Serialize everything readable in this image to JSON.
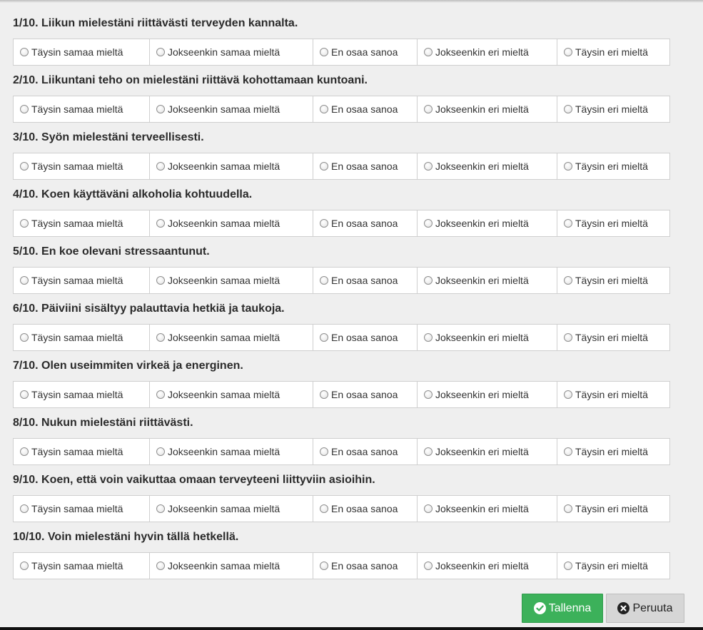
{
  "options": [
    "Täysin samaa mieltä",
    "Jokseenkin samaa mieltä",
    "En osaa sanoa",
    "Jokseenkin eri mieltä",
    "Täysin eri mieltä"
  ],
  "questions": [
    "1/10. Liikun mielestäni riittävästi terveyden kannalta.",
    "2/10. Liikuntani teho on mielestäni riittävä kohottamaan kuntoani.",
    "3/10. Syön mielestäni terveellisesti.",
    "4/10. Koen käyttäväni alkoholia kohtuudella.",
    "5/10. En koe olevani stressaantunut.",
    "6/10. Päiviini sisältyy palauttavia hetkiä ja taukoja.",
    "7/10. Olen useimmiten virkeä ja energinen.",
    "8/10. Nukun mielestäni riittävästi.",
    "9/10. Koen, että voin vaikuttaa omaan terveyteeni liittyviin asioihin.",
    "10/10. Voin mielestäni hyvin tällä hetkellä."
  ],
  "buttons": {
    "save_label": "Tallenna",
    "save_icon": "check-circle-icon",
    "cancel_label": "Peruuta",
    "cancel_icon": "close-circle-icon"
  },
  "colors": {
    "save_bg": "#3cb15a",
    "cancel_bg": "#d6d6d6",
    "background": "#efefef"
  }
}
